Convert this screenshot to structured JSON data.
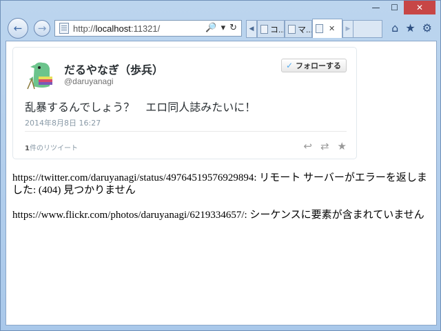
{
  "titlebar": {
    "minimize": "—",
    "maximize": "☐",
    "close": "✕"
  },
  "address": {
    "prefix": "http://",
    "host": "localhost",
    "suffix": ":11321/",
    "search_icon": "🔎",
    "dropdown_icon": "▾",
    "refresh_icon": "↻"
  },
  "tabs": [
    {
      "label": "コ..."
    },
    {
      "label": "マ..."
    },
    {
      "label": "",
      "active": true
    }
  ],
  "tab_close": "✕",
  "tools": {
    "home": "⌂",
    "favorites": "★",
    "settings": "⚙"
  },
  "tweet": {
    "author_name": "だるやなぎ（歩兵）",
    "author_handle": "@daruyanagi",
    "follow_label": "フォローする",
    "text": "乱暴するんでしょう？　エロ同人誌みたいに！",
    "date": "2014年8月8日 16:27",
    "retweet_count": "1",
    "retweet_suffix": "件のリツイート",
    "actions": {
      "reply": "↩",
      "retweet": "⇄",
      "favorite": "★"
    }
  },
  "messages": [
    "https://twitter.com/daruyanagi/status/497645195769298​94: リモート サーバーがエラーを返しました: (404) 見つかりません",
    "https://www.flickr.com/photos/daruyanagi/6219334657/: シーケンスに要素が含まれていません"
  ],
  "colors": {
    "twitter_blue": "#55acee",
    "close_red": "#c74646",
    "frame_blue": "#bcd5ee"
  }
}
